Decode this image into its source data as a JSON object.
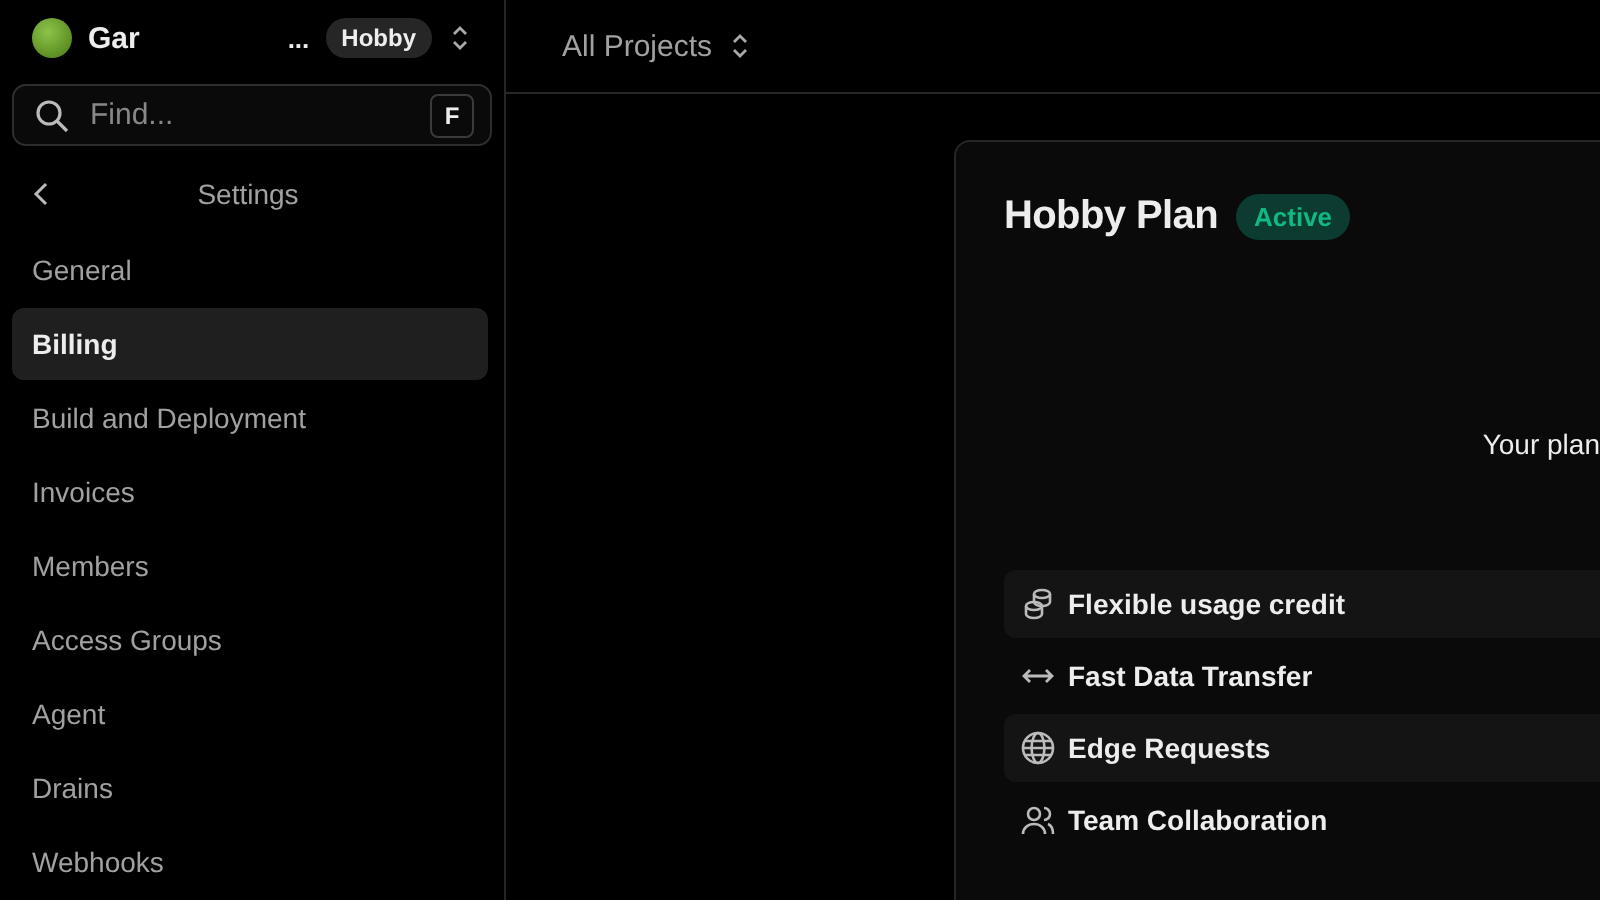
{
  "team": {
    "name": "Gar",
    "ellipsis": "...",
    "plan_badge": "Hobby"
  },
  "search": {
    "placeholder": "Find...",
    "shortcut": "F"
  },
  "sidebar": {
    "title": "Settings",
    "items": [
      {
        "label": "General",
        "selected": false
      },
      {
        "label": "Billing",
        "selected": true
      },
      {
        "label": "Build and Deployment",
        "selected": false
      },
      {
        "label": "Invoices",
        "selected": false
      },
      {
        "label": "Members",
        "selected": false
      },
      {
        "label": "Access Groups",
        "selected": false
      },
      {
        "label": "Agent",
        "selected": false
      },
      {
        "label": "Drains",
        "selected": false
      },
      {
        "label": "Webhooks",
        "selected": false
      }
    ]
  },
  "top_bar": {
    "project_selector": "All Projects"
  },
  "plan_card": {
    "title": "Hobby Plan",
    "status": "Active",
    "subtitle": "Your plan",
    "features": [
      {
        "kind": "credit",
        "label": "Flexible usage credit"
      },
      {
        "kind": "transfer",
        "label": "Fast Data Transfer"
      },
      {
        "kind": "globe",
        "label": "Edge Requests"
      },
      {
        "kind": "team",
        "label": "Team Collaboration"
      }
    ]
  }
}
